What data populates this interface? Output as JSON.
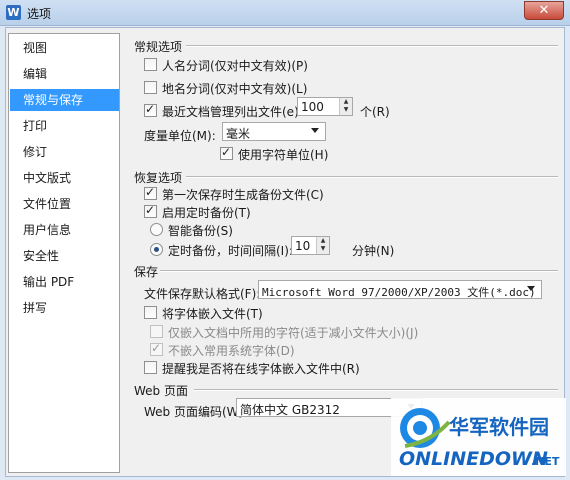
{
  "window": {
    "title": "选项",
    "app_icon": "W"
  },
  "sidebar": {
    "items": [
      {
        "label": "视图",
        "selected": false
      },
      {
        "label": "编辑",
        "selected": false
      },
      {
        "label": "常规与保存",
        "selected": true
      },
      {
        "label": "打印",
        "selected": false
      },
      {
        "label": "修订",
        "selected": false
      },
      {
        "label": "中文版式",
        "selected": false
      },
      {
        "label": "文件位置",
        "selected": false
      },
      {
        "label": "用户信息",
        "selected": false
      },
      {
        "label": "安全性",
        "selected": false
      },
      {
        "label": "输出 PDF",
        "selected": false
      },
      {
        "label": "拼写",
        "selected": false
      }
    ]
  },
  "general": {
    "title": "常规选项",
    "person_names": {
      "label": "人名分词(仅对中文有效)(P)",
      "checked": false
    },
    "place_names": {
      "label": "地名分词(仅对中文有效)(L)",
      "checked": false
    },
    "recent_files": {
      "label": "最近文档管理列出文件(e):",
      "checked": true,
      "value": "100",
      "unit": "个(R)"
    },
    "measure_unit": {
      "label": "度量单位(M):",
      "value": "毫米"
    },
    "char_unit": {
      "label": "使用字符单位(H)",
      "checked": true
    }
  },
  "backup": {
    "title": "恢复选项",
    "first_save_backup": {
      "label": "第一次保存时生成备份文件(C)",
      "checked": true
    },
    "timed_backup": {
      "label": "启用定时备份(T)",
      "checked": true
    },
    "smart_backup": {
      "label": "智能备份(S)",
      "selected": false
    },
    "timed_interval": {
      "label": "定时备份，时间间隔(I):",
      "selected": true,
      "value": "10",
      "unit": "分钟(N)"
    }
  },
  "save": {
    "title": "保存",
    "default_format": {
      "label": "文件保存默认格式(F):",
      "value": "Microsoft Word 97/2000/XP/2003 文件(*.doc)"
    },
    "embed_fonts": {
      "label": "将字体嵌入文件(T)",
      "checked": false
    },
    "embed_used_only": {
      "label": "仅嵌入文档中所用的字符(适于减小文件大小)(J)",
      "checked": false
    },
    "no_common_fonts": {
      "label": "不嵌入常用系统字体(D)",
      "checked": true
    },
    "remind_online_fonts": {
      "label": "提醒我是否将在线字体嵌入文件中(R)",
      "checked": false
    }
  },
  "web": {
    "title": "Web 页面",
    "encoding": {
      "label": "Web 页面编码(W):",
      "value": "简体中文 GB2312"
    }
  },
  "watermark": {
    "cn": "华军软件园",
    "brand": "ONLINEDOWN",
    "tld": ".NET"
  },
  "colors": {
    "accent": "#3399ff",
    "watermark_blue": "#1565c0"
  }
}
